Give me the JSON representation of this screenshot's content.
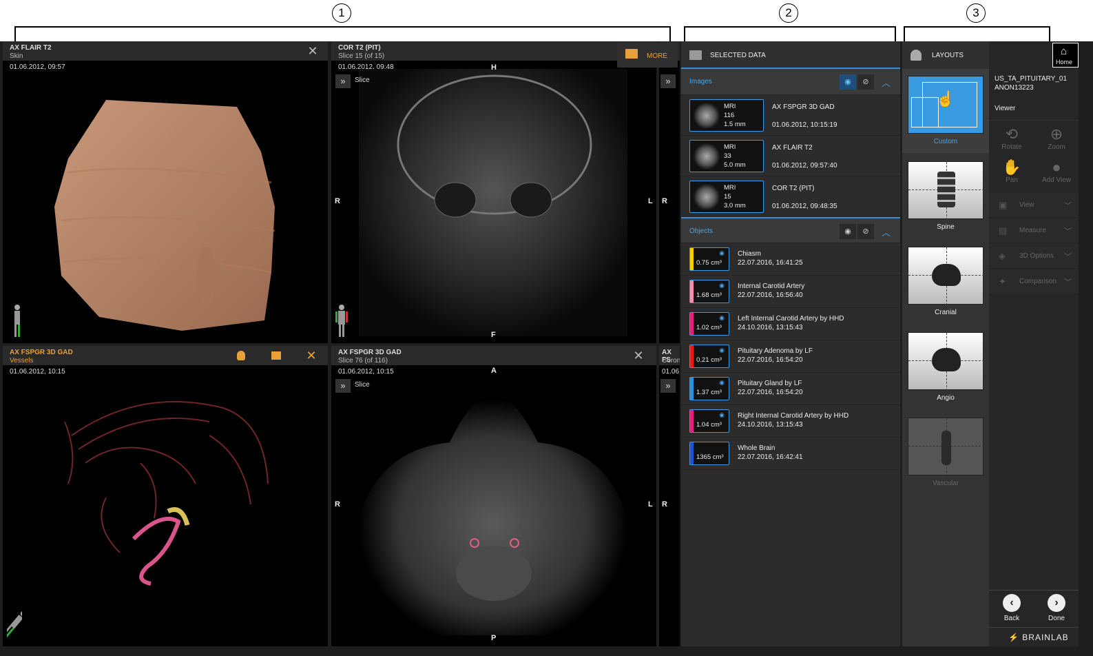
{
  "callouts": [
    "1",
    "2",
    "3"
  ],
  "viewports": {
    "top_left": {
      "title": "AX FLAIR T2",
      "subtitle": "Skin",
      "date": "01.06.2012, 09:57"
    },
    "top_mid": {
      "title": "COR T2 (PIT)",
      "subtitle": "Slice 15 (of 15)",
      "date": "01.06.2012, 09:48",
      "slice_label": "Slice",
      "ori_top": "H",
      "ori_bottom": "F",
      "ori_left": "R",
      "ori_right": "L"
    },
    "top_right": {
      "ori_left": "R"
    },
    "bottom_left": {
      "title": "AX FSPGR 3D GAD",
      "subtitle": "Vessels",
      "date": "01.06.2012, 10:15"
    },
    "bottom_mid": {
      "title": "AX FSPGR 3D GAD",
      "subtitle": "Slice 76 (of 116)",
      "date": "01.06.2012, 10:15",
      "slice_label": "Slice",
      "ori_top": "A",
      "ori_bottom": "P",
      "ori_left": "R",
      "ori_right": "L"
    },
    "bottom_right": {
      "title": "AX FS",
      "subtitle": "Coron",
      "date": "01.06.",
      "ori_left": "R"
    }
  },
  "more_button": {
    "label": "MORE"
  },
  "selected_data": {
    "title": "SELECTED DATA",
    "images_header": "Images",
    "images": [
      {
        "modality": "MRI",
        "count": "116",
        "thickness": "1.5 mm",
        "name": "AX FSPGR 3D GAD",
        "date": "01.06.2012, 10:15:19"
      },
      {
        "modality": "MRI",
        "count": "33",
        "thickness": "5.0 mm",
        "name": "AX FLAIR T2",
        "date": "01.06.2012, 09:57:40"
      },
      {
        "modality": "MRI",
        "count": "15",
        "thickness": "3.0 mm",
        "name": "COR T2 (PIT)",
        "date": "01.06.2012, 09:48:35"
      }
    ],
    "objects_header": "Objects",
    "objects": [
      {
        "volume": "0.75 cm³",
        "name": "Chiasm",
        "date": "22.07.2016, 16:41:25",
        "color": "#f2d200"
      },
      {
        "volume": "1.68 cm³",
        "name": "Internal Carotid Artery",
        "date": "22.07.2016, 16:56:40",
        "color": "#f48fb1"
      },
      {
        "volume": "1.02 cm³",
        "name": "Left Internal Carotid Artery by HHD",
        "date": "24.10.2016, 13:15:43",
        "color": "#e0207a"
      },
      {
        "volume": "0.21 cm³",
        "name": "Pituitary Adenoma by LF",
        "date": "22.07.2016, 16:54:20",
        "color": "#e41b1b"
      },
      {
        "volume": "1.37 cm³",
        "name": "Pituitary Gland by LF",
        "date": "22.07.2016, 16:54:20",
        "color": "#2b8fe0"
      },
      {
        "volume": "1.04 cm³",
        "name": "Right Internal Carotid Artery by HHD",
        "date": "24.10.2016, 13:15:43",
        "color": "#e0207a"
      },
      {
        "volume": "1365 cm³",
        "name": "Whole Brain",
        "date": "22.07.2016, 16:42:41",
        "color": "#1f4fd8"
      }
    ]
  },
  "layouts": {
    "title": "LAYOUTS",
    "items": [
      {
        "label": "Custom"
      },
      {
        "label": "Spine"
      },
      {
        "label": "Cranial"
      },
      {
        "label": "Angio"
      },
      {
        "label": "Vascular"
      }
    ]
  },
  "right_panel": {
    "home_label": "Home",
    "patient_line1": "US_TA_PITUITARY_01",
    "patient_line2": "ANON13223",
    "viewer_label": "Viewer",
    "tools": [
      "Rotate",
      "Zoom",
      "Pan",
      "Add View"
    ],
    "menus": [
      "View",
      "Measure",
      "3D Options",
      "Comparison"
    ],
    "back_label": "Back",
    "done_label": "Done",
    "brand": "BRAINLAB"
  }
}
